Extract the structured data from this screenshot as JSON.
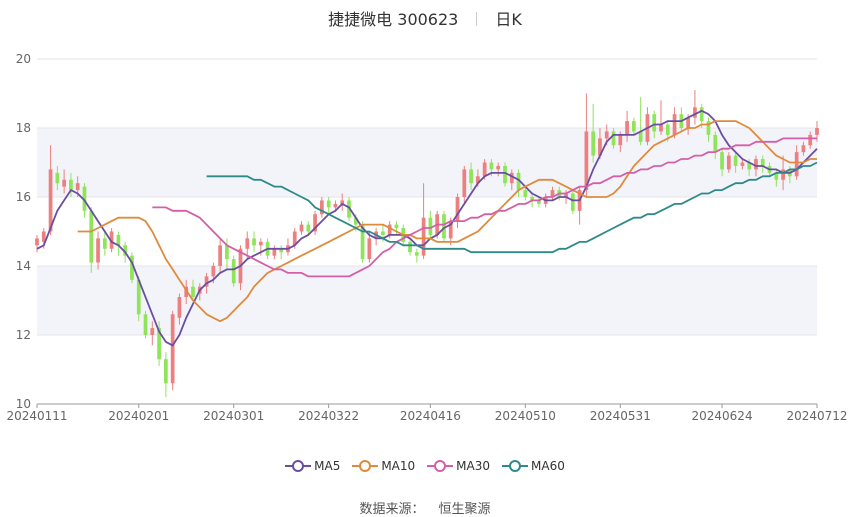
{
  "header": {
    "stock_name": "捷捷微电",
    "stock_code": "300623",
    "period": "日K"
  },
  "legend": [
    {
      "name": "MA5",
      "color": "#6a4ea1"
    },
    {
      "name": "MA10",
      "color": "#e08a3c"
    },
    {
      "name": "MA30",
      "color": "#d45fa8"
    },
    {
      "name": "MA60",
      "color": "#2e8a8a"
    }
  ],
  "source": {
    "label": "数据来源：",
    "value": "恒生聚源"
  },
  "colors": {
    "up": "#ec7f7f",
    "down": "#8fe45a",
    "band": "#f3f4fa",
    "grid": "#e6e6e6"
  },
  "chart_data": {
    "type": "candlestick",
    "ylim": [
      10,
      20
    ],
    "yticks": [
      10,
      12,
      14,
      16,
      18,
      20
    ],
    "x_tick_labels": [
      "20240111",
      "20240201",
      "20240301",
      "20240322",
      "20240416",
      "20240510",
      "20240531",
      "20240624",
      "20240712"
    ],
    "x_tick_index": [
      0,
      15,
      29,
      43,
      58,
      72,
      86,
      101,
      115
    ],
    "candles": [
      [
        14.6,
        14.8,
        14.4,
        14.9
      ],
      [
        14.7,
        15.0,
        14.5,
        15.1
      ],
      [
        15.0,
        16.8,
        14.9,
        17.5
      ],
      [
        16.7,
        16.4,
        16.2,
        16.9
      ],
      [
        16.3,
        16.5,
        16.1,
        16.8
      ],
      [
        16.5,
        16.2,
        16.0,
        16.7
      ],
      [
        16.2,
        16.4,
        16.0,
        16.6
      ],
      [
        16.3,
        15.6,
        15.4,
        16.4
      ],
      [
        15.6,
        14.1,
        13.8,
        15.7
      ],
      [
        14.1,
        14.8,
        13.9,
        15.0
      ],
      [
        14.8,
        14.5,
        14.3,
        15.0
      ],
      [
        14.5,
        15.0,
        14.4,
        15.1
      ],
      [
        14.9,
        14.6,
        14.3,
        15.0
      ],
      [
        14.6,
        14.3,
        14.1,
        14.7
      ],
      [
        14.3,
        13.6,
        13.5,
        14.4
      ],
      [
        13.6,
        12.6,
        12.4,
        13.7
      ],
      [
        12.6,
        12.0,
        11.9,
        12.7
      ],
      [
        12.0,
        12.2,
        11.7,
        12.4
      ],
      [
        12.2,
        11.3,
        11.1,
        12.4
      ],
      [
        11.3,
        10.6,
        10.2,
        11.5
      ],
      [
        10.6,
        12.6,
        10.4,
        12.7
      ],
      [
        12.5,
        13.1,
        12.3,
        13.2
      ],
      [
        13.1,
        13.4,
        12.9,
        13.6
      ],
      [
        13.4,
        13.1,
        13.0,
        13.6
      ],
      [
        13.2,
        13.4,
        13.0,
        13.5
      ],
      [
        13.4,
        13.7,
        13.2,
        13.8
      ],
      [
        13.7,
        14.0,
        13.5,
        14.1
      ],
      [
        14.0,
        14.6,
        13.8,
        14.8
      ],
      [
        14.6,
        14.2,
        13.9,
        14.8
      ],
      [
        14.2,
        13.5,
        13.4,
        14.3
      ],
      [
        13.5,
        14.5,
        13.3,
        14.6
      ],
      [
        14.5,
        14.8,
        14.2,
        15.0
      ],
      [
        14.8,
        14.6,
        14.4,
        15.0
      ],
      [
        14.6,
        14.7,
        14.3,
        14.8
      ],
      [
        14.7,
        14.3,
        14.2,
        14.8
      ],
      [
        14.3,
        14.5,
        14.2,
        14.6
      ],
      [
        14.5,
        14.4,
        14.2,
        14.6
      ],
      [
        14.4,
        14.6,
        14.3,
        14.8
      ],
      [
        14.6,
        15.0,
        14.5,
        15.1
      ],
      [
        15.0,
        15.2,
        14.9,
        15.3
      ],
      [
        15.2,
        15.0,
        14.9,
        15.3
      ],
      [
        15.0,
        15.5,
        14.9,
        15.6
      ],
      [
        15.5,
        15.9,
        15.4,
        16.0
      ],
      [
        15.9,
        15.7,
        15.5,
        16.0
      ],
      [
        15.7,
        15.8,
        15.6,
        15.9
      ],
      [
        15.8,
        15.9,
        15.6,
        16.1
      ],
      [
        15.9,
        15.4,
        15.3,
        16.0
      ],
      [
        15.4,
        15.2,
        15.0,
        15.5
      ],
      [
        15.2,
        14.2,
        14.1,
        15.3
      ],
      [
        14.2,
        14.8,
        14.1,
        15.0
      ],
      [
        14.8,
        15.0,
        14.6,
        15.1
      ],
      [
        15.0,
        14.9,
        14.7,
        15.2
      ],
      [
        14.9,
        15.2,
        14.8,
        15.3
      ],
      [
        15.2,
        15.1,
        14.9,
        15.3
      ],
      [
        15.1,
        14.7,
        14.6,
        15.2
      ],
      [
        14.7,
        14.4,
        14.3,
        14.8
      ],
      [
        14.4,
        14.3,
        14.1,
        14.5
      ],
      [
        14.3,
        15.4,
        14.2,
        16.4
      ],
      [
        15.4,
        14.9,
        14.8,
        15.6
      ],
      [
        14.9,
        15.5,
        14.8,
        15.6
      ],
      [
        15.5,
        14.8,
        14.7,
        15.6
      ],
      [
        14.8,
        15.3,
        14.6,
        15.4
      ],
      [
        15.3,
        16.0,
        15.1,
        16.1
      ],
      [
        16.0,
        16.8,
        15.8,
        16.9
      ],
      [
        16.8,
        16.4,
        16.2,
        17.0
      ],
      [
        16.4,
        16.6,
        16.3,
        16.8
      ],
      [
        16.6,
        17.0,
        16.5,
        17.1
      ],
      [
        17.0,
        16.8,
        16.6,
        17.1
      ],
      [
        16.8,
        16.9,
        16.6,
        17.0
      ],
      [
        16.9,
        16.4,
        16.3,
        17.0
      ],
      [
        16.4,
        16.7,
        16.2,
        16.8
      ],
      [
        16.7,
        16.2,
        16.0,
        16.8
      ],
      [
        16.2,
        16.0,
        15.9,
        16.3
      ],
      [
        16.0,
        15.9,
        15.7,
        16.1
      ],
      [
        15.9,
        15.8,
        15.7,
        16.0
      ],
      [
        15.8,
        16.0,
        15.7,
        16.1
      ],
      [
        16.0,
        16.2,
        15.9,
        16.3
      ],
      [
        16.2,
        16.0,
        15.9,
        16.3
      ],
      [
        16.0,
        16.1,
        15.8,
        16.2
      ],
      [
        16.1,
        15.6,
        15.5,
        16.2
      ],
      [
        15.6,
        16.2,
        15.2,
        16.3
      ],
      [
        16.2,
        17.9,
        16.0,
        19.0
      ],
      [
        17.9,
        17.2,
        17.0,
        18.7
      ],
      [
        17.2,
        17.7,
        17.1,
        18.0
      ],
      [
        17.7,
        17.9,
        17.5,
        18.1
      ],
      [
        17.9,
        17.5,
        17.4,
        18.0
      ],
      [
        17.5,
        17.8,
        17.3,
        17.9
      ],
      [
        17.8,
        18.2,
        17.6,
        18.5
      ],
      [
        18.2,
        17.9,
        17.8,
        18.3
      ],
      [
        17.9,
        17.6,
        17.5,
        18.9
      ],
      [
        17.6,
        18.4,
        17.5,
        18.6
      ],
      [
        18.4,
        17.9,
        17.7,
        18.5
      ],
      [
        17.9,
        18.1,
        17.8,
        18.8
      ],
      [
        18.1,
        17.8,
        17.6,
        18.2
      ],
      [
        17.8,
        18.4,
        17.7,
        18.6
      ],
      [
        18.4,
        18.0,
        17.9,
        18.6
      ],
      [
        18.0,
        18.3,
        17.8,
        18.4
      ],
      [
        18.3,
        18.6,
        18.1,
        19.1
      ],
      [
        18.6,
        18.2,
        18.0,
        18.7
      ],
      [
        18.2,
        17.8,
        17.6,
        18.3
      ],
      [
        17.8,
        17.3,
        17.1,
        17.9
      ],
      [
        17.3,
        16.8,
        16.6,
        17.4
      ],
      [
        16.8,
        17.2,
        16.7,
        17.3
      ],
      [
        17.2,
        16.9,
        16.7,
        17.3
      ],
      [
        16.9,
        17.0,
        16.8,
        17.1
      ],
      [
        17.0,
        16.8,
        16.6,
        17.1
      ],
      [
        16.8,
        17.1,
        16.6,
        17.2
      ],
      [
        17.1,
        16.9,
        16.7,
        17.2
      ],
      [
        16.9,
        16.7,
        16.6,
        17.0
      ],
      [
        16.7,
        16.5,
        16.3,
        16.8
      ],
      [
        16.5,
        16.8,
        16.2,
        17.2
      ],
      [
        16.8,
        16.6,
        16.4,
        16.9
      ],
      [
        16.6,
        17.3,
        16.5,
        17.5
      ],
      [
        17.3,
        17.5,
        17.2,
        17.6
      ],
      [
        17.5,
        17.8,
        17.4,
        17.9
      ],
      [
        17.8,
        18.0,
        17.6,
        18.2
      ]
    ],
    "series": [
      {
        "name": "MA5",
        "values": [
          14.5,
          14.6,
          15.1,
          15.6,
          15.9,
          16.2,
          16.1,
          15.9,
          15.6,
          15.3,
          15.0,
          14.7,
          14.6,
          14.4,
          14.1,
          13.6,
          13.1,
          12.6,
          12.1,
          11.8,
          11.7,
          12.0,
          12.5,
          12.9,
          13.3,
          13.5,
          13.6,
          13.8,
          13.9,
          13.9,
          14.0,
          14.2,
          14.3,
          14.4,
          14.5,
          14.5,
          14.5,
          14.5,
          14.6,
          14.8,
          14.9,
          15.1,
          15.3,
          15.5,
          15.6,
          15.8,
          15.7,
          15.4,
          15.1,
          14.9,
          14.8,
          14.8,
          14.9,
          14.9,
          14.9,
          14.8,
          14.6,
          14.6,
          14.8,
          14.9,
          15.1,
          15.2,
          15.5,
          15.8,
          16.1,
          16.4,
          16.6,
          16.7,
          16.7,
          16.7,
          16.6,
          16.5,
          16.3,
          16.1,
          16.0,
          15.9,
          15.9,
          16.0,
          16.0,
          15.9,
          15.9,
          16.3,
          16.8,
          17.2,
          17.6,
          17.8,
          17.8,
          17.8,
          17.8,
          17.9,
          18.0,
          18.1,
          18.1,
          18.2,
          18.2,
          18.2,
          18.3,
          18.4,
          18.5,
          18.4,
          18.2,
          17.8,
          17.5,
          17.3,
          17.1,
          17.0,
          16.9,
          16.9,
          16.8,
          16.8,
          16.7,
          16.7,
          16.8,
          17.0,
          17.2,
          17.4
        ]
      },
      {
        "name": "MA10",
        "values": [
          15.0,
          15.0,
          15.0,
          15.1,
          15.2,
          15.3,
          15.4,
          15.4,
          15.4,
          15.4,
          15.3,
          15.0,
          14.6,
          14.2,
          13.9,
          13.6,
          13.3,
          13.0,
          12.8,
          12.6,
          12.5,
          12.4,
          12.5,
          12.7,
          12.9,
          13.1,
          13.4,
          13.6,
          13.8,
          13.9,
          14.0,
          14.1,
          14.2,
          14.3,
          14.4,
          14.5,
          14.6,
          14.7,
          14.8,
          14.9,
          15.0,
          15.1,
          15.2,
          15.2,
          15.2,
          15.2,
          15.1,
          15.0,
          14.9,
          14.9,
          14.8,
          14.8,
          14.8,
          14.7,
          14.7,
          14.7,
          14.7,
          14.8,
          14.9,
          15.0,
          15.2,
          15.4,
          15.6,
          15.8,
          16.0,
          16.2,
          16.3,
          16.4,
          16.5,
          16.5,
          16.5,
          16.4,
          16.3,
          16.2,
          16.1,
          16.0,
          16.0,
          16.0,
          16.0,
          16.1,
          16.3,
          16.6,
          16.9,
          17.1,
          17.3,
          17.5,
          17.6,
          17.7,
          17.8,
          17.9,
          18.0,
          18.0,
          18.1,
          18.1,
          18.2,
          18.2,
          18.2,
          18.2,
          18.1,
          18.0,
          17.8,
          17.6,
          17.4,
          17.2,
          17.1,
          17.0,
          17.0,
          17.0,
          17.1,
          17.1
        ]
      },
      {
        "name": "MA30",
        "values": [
          15.7,
          15.7,
          15.7,
          15.6,
          15.6,
          15.6,
          15.5,
          15.4,
          15.2,
          15.0,
          14.8,
          14.6,
          14.5,
          14.4,
          14.3,
          14.2,
          14.1,
          14.0,
          13.9,
          13.9,
          13.8,
          13.8,
          13.8,
          13.7,
          13.7,
          13.7,
          13.7,
          13.7,
          13.7,
          13.7,
          13.8,
          13.9,
          14.0,
          14.2,
          14.4,
          14.5,
          14.7,
          14.8,
          14.9,
          15.0,
          15.1,
          15.1,
          15.2,
          15.2,
          15.3,
          15.3,
          15.3,
          15.4,
          15.4,
          15.5,
          15.5,
          15.6,
          15.6,
          15.7,
          15.8,
          15.8,
          15.9,
          15.9,
          16.0,
          16.0,
          16.1,
          16.1,
          16.2,
          16.3,
          16.3,
          16.4,
          16.4,
          16.5,
          16.6,
          16.6,
          16.7,
          16.7,
          16.8,
          16.8,
          16.9,
          16.9,
          17.0,
          17.0,
          17.1,
          17.1,
          17.2,
          17.2,
          17.3,
          17.3,
          17.4,
          17.4,
          17.5,
          17.5,
          17.5,
          17.6,
          17.6,
          17.6,
          17.6,
          17.7,
          17.7,
          17.7,
          17.7,
          17.7,
          17.7
        ]
      },
      {
        "name": "MA60",
        "values": [
          16.6,
          16.6,
          16.6,
          16.6,
          16.6,
          16.6,
          16.6,
          16.5,
          16.5,
          16.4,
          16.3,
          16.3,
          16.2,
          16.1,
          16.0,
          15.9,
          15.7,
          15.6,
          15.5,
          15.4,
          15.3,
          15.2,
          15.1,
          15.0,
          15.0,
          14.9,
          14.8,
          14.7,
          14.7,
          14.6,
          14.6,
          14.6,
          14.5,
          14.5,
          14.5,
          14.5,
          14.5,
          14.5,
          14.5,
          14.4,
          14.4,
          14.4,
          14.4,
          14.4,
          14.4,
          14.4,
          14.4,
          14.4,
          14.4,
          14.4,
          14.4,
          14.4,
          14.5,
          14.5,
          14.6,
          14.7,
          14.7,
          14.8,
          14.9,
          15.0,
          15.1,
          15.2,
          15.3,
          15.4,
          15.4,
          15.5,
          15.5,
          15.6,
          15.7,
          15.8,
          15.8,
          15.9,
          16.0,
          16.1,
          16.1,
          16.2,
          16.2,
          16.3,
          16.4,
          16.4,
          16.5,
          16.5,
          16.6,
          16.6,
          16.7,
          16.7,
          16.8,
          16.8,
          16.9,
          16.9,
          17.0
        ]
      }
    ]
  }
}
